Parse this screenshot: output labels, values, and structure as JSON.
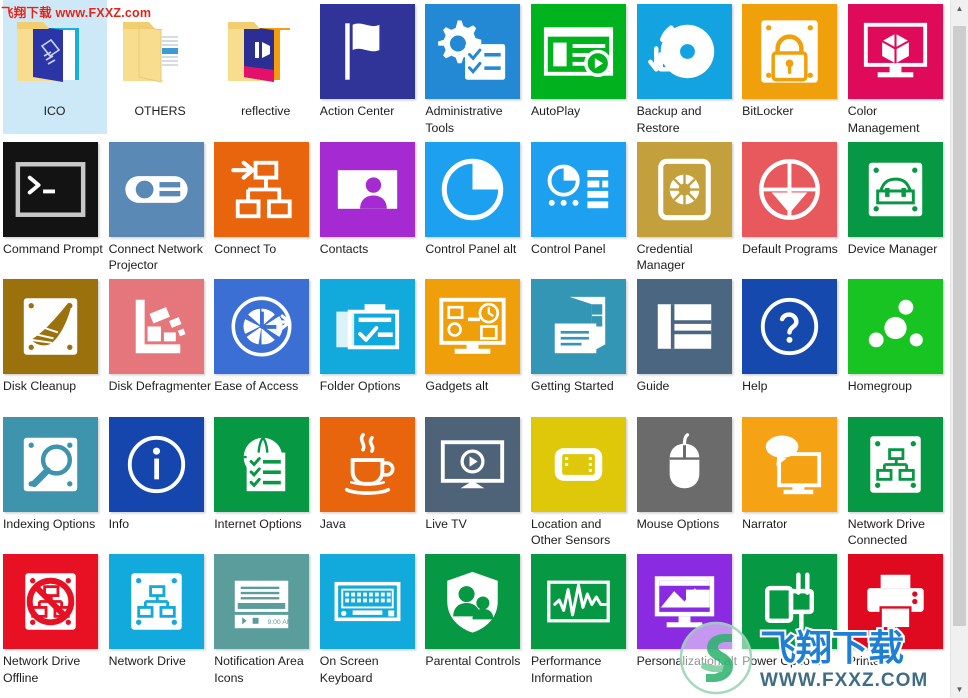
{
  "window": {
    "view_mode": "Large icons",
    "watermark_top": "飞翔下载 www.FXXZ.com",
    "watermark_logo_cn": "飞翔下载",
    "watermark_logo_url": "WWW.FXXZ.COM",
    "scrollbar_up_icon": "scroll-up-arrow",
    "scrollbar_down_icon": "scroll-down-arrow"
  },
  "items": [
    {
      "label": "ICO",
      "kind": "folder",
      "icon": "folder-ico",
      "color": "#f2d06b",
      "selected": true
    },
    {
      "label": "OTHERS",
      "kind": "folder",
      "icon": "folder-others",
      "color": "#f2d06b",
      "selected": false
    },
    {
      "label": "reflective",
      "kind": "folder",
      "icon": "folder-reflective",
      "color": "#f2d06b",
      "selected": false
    },
    {
      "label": "Action Center",
      "kind": "tile",
      "icon": "flag-icon",
      "color": "#303499",
      "selected": false
    },
    {
      "label": "Administrative Tools",
      "kind": "tile",
      "icon": "gear-checklist-icon",
      "color": "#2389d4",
      "selected": false
    },
    {
      "label": "AutoPlay",
      "kind": "tile",
      "icon": "media-window-play-icon",
      "color": "#00b21e",
      "selected": false
    },
    {
      "label": "Backup and Restore",
      "kind": "tile",
      "icon": "disc-sync-arrows-icon",
      "color": "#13a3e0",
      "selected": false
    },
    {
      "label": "BitLocker",
      "kind": "tile",
      "icon": "drive-lock-icon",
      "color": "#efa00b",
      "selected": false
    },
    {
      "label": "Color Management",
      "kind": "tile",
      "icon": "monitor-cube-icon",
      "color": "#e00a5a",
      "selected": false
    },
    {
      "label": "Command Prompt",
      "kind": "tile",
      "icon": "console-prompt-icon",
      "color": "#131313",
      "selected": false
    },
    {
      "label": "Connect Network Projector",
      "kind": "tile",
      "icon": "projector-icon",
      "color": "#5b89b5",
      "selected": false
    },
    {
      "label": "Connect To",
      "kind": "tile",
      "icon": "network-connect-icon",
      "color": "#e8650d",
      "selected": false
    },
    {
      "label": "Contacts",
      "kind": "tile",
      "icon": "contact-card-icon",
      "color": "#a52ad2",
      "selected": false
    },
    {
      "label": "Control Panel alt",
      "kind": "tile",
      "icon": "pie-chart-icon",
      "color": "#1ea0f0",
      "selected": false
    },
    {
      "label": "Control Panel",
      "kind": "tile",
      "icon": "pie-list-icon",
      "color": "#1ea0f0",
      "selected": false
    },
    {
      "label": "Credential Manager",
      "kind": "tile",
      "icon": "credential-card-icon",
      "color": "#c3a03c",
      "selected": false
    },
    {
      "label": "Default Programs",
      "kind": "tile",
      "icon": "default-target-icon",
      "color": "#e8595d",
      "selected": false
    },
    {
      "label": "Device Manager",
      "kind": "tile",
      "icon": "device-toolbox-icon",
      "color": "#069843",
      "selected": false
    },
    {
      "label": "Disk Cleanup",
      "kind": "tile",
      "icon": "broom-disk-icon",
      "color": "#9a710c",
      "selected": false
    },
    {
      "label": "Disk Defragmenter",
      "kind": "tile",
      "icon": "defrag-blocks-icon",
      "color": "#e5767b",
      "selected": false
    },
    {
      "label": "Ease of Access",
      "kind": "tile",
      "icon": "clock-access-icon",
      "color": "#3b6fd4",
      "selected": false
    },
    {
      "label": "Folder Options",
      "kind": "tile",
      "icon": "folder-check-icon",
      "color": "#12aadc",
      "selected": false
    },
    {
      "label": "Gadgets alt",
      "kind": "tile",
      "icon": "monitor-gadgets-icon",
      "color": "#ef9f0a",
      "selected": false
    },
    {
      "label": "Getting Started",
      "kind": "tile",
      "icon": "windows-doc-icon",
      "color": "#3296b4",
      "selected": false
    },
    {
      "label": "Guide",
      "kind": "tile",
      "icon": "layout-panes-icon",
      "color": "#4a6680",
      "selected": false
    },
    {
      "label": "Help",
      "kind": "tile",
      "icon": "question-circle-icon",
      "color": "#1649ad",
      "selected": false
    },
    {
      "label": "Homegroup",
      "kind": "tile",
      "icon": "homegroup-nodes-icon",
      "color": "#18c421",
      "selected": false
    },
    {
      "label": "Indexing Options",
      "kind": "tile",
      "icon": "drive-search-icon",
      "color": "#3e93ad",
      "selected": false
    },
    {
      "label": "Info",
      "kind": "tile",
      "icon": "info-circle-icon",
      "color": "#1446ad",
      "selected": false
    },
    {
      "label": "Internet Options",
      "kind": "tile",
      "icon": "globe-checklist-icon",
      "color": "#069843",
      "selected": false
    },
    {
      "label": "Java",
      "kind": "tile",
      "icon": "java-coffee-icon",
      "color": "#e8650d",
      "selected": false
    },
    {
      "label": "Live TV",
      "kind": "tile",
      "icon": "tv-play-icon",
      "color": "#4e6378",
      "selected": false
    },
    {
      "label": "Location and Other Sensors",
      "kind": "tile",
      "icon": "device-sensor-icon",
      "color": "#dfc80a",
      "selected": false
    },
    {
      "label": "Mouse Options",
      "kind": "tile",
      "icon": "mouse-icon",
      "color": "#6b6b6b",
      "selected": false
    },
    {
      "label": "Narrator",
      "kind": "tile",
      "icon": "monitor-speech-icon",
      "color": "#f5a214",
      "selected": false
    },
    {
      "label": "Network Drive Connected",
      "kind": "tile",
      "icon": "drive-network-icon",
      "color": "#069843",
      "selected": false
    },
    {
      "label": "Network Drive Offline",
      "kind": "tile",
      "icon": "drive-network-offline-icon",
      "color": "#e81123",
      "selected": false
    },
    {
      "label": "Network Drive",
      "kind": "tile",
      "icon": "drive-network-blue-icon",
      "color": "#12aadc",
      "selected": false
    },
    {
      "label": "Notification Area Icons",
      "kind": "tile",
      "icon": "notification-taskbar-icon",
      "color": "#5a9d9b",
      "selected": false
    },
    {
      "label": "On Screen Keyboard",
      "kind": "tile",
      "icon": "keyboard-icon",
      "color": "#12aadc",
      "selected": false
    },
    {
      "label": "Parental Controls",
      "kind": "tile",
      "icon": "shield-family-icon",
      "color": "#069843",
      "selected": false
    },
    {
      "label": "Performance Information",
      "kind": "tile",
      "icon": "waveform-monitor-icon",
      "color": "#069843",
      "selected": false
    },
    {
      "label": "Personalization alt",
      "kind": "tile",
      "icon": "monitor-picture-icon",
      "color": "#8a2be2",
      "selected": false
    },
    {
      "label": "Power Options",
      "kind": "tile",
      "icon": "power-plug-icon",
      "color": "#069843",
      "selected": false
    },
    {
      "label": "Printer",
      "kind": "tile",
      "icon": "printer-icon",
      "color": "#e00a20",
      "selected": false
    }
  ]
}
